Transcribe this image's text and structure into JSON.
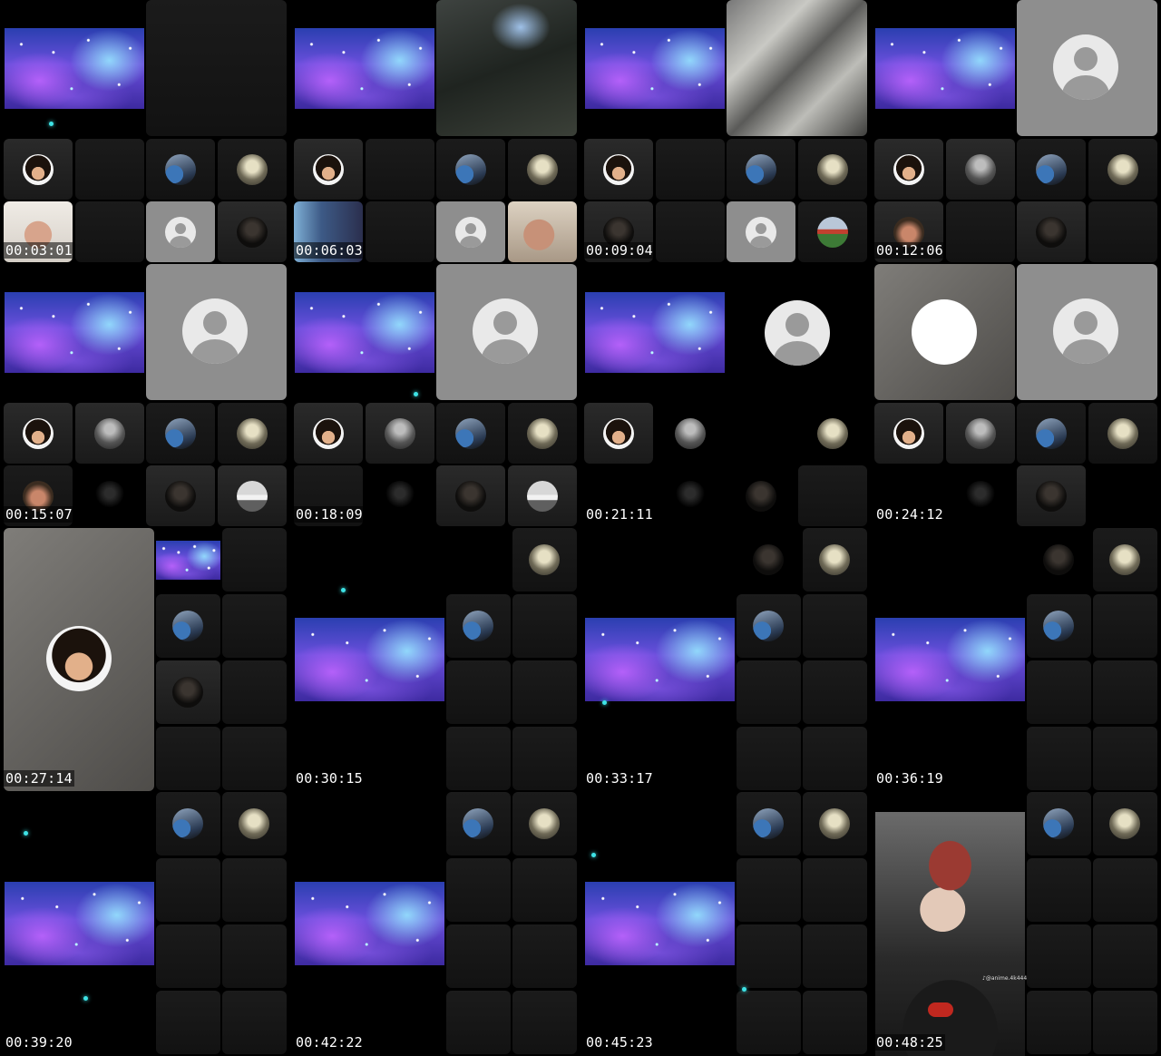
{
  "timestamps": [
    "00:03:01",
    "00:06:03",
    "00:09:04",
    "00:12:06",
    "00:15:07",
    "00:18:09",
    "00:21:11",
    "00:24:12",
    "00:27:14",
    "00:30:15",
    "00:33:17",
    "00:36:19",
    "00:39:20",
    "00:42:22",
    "00:45:23",
    "00:48:25"
  ],
  "overlay_text": {
    "anime_watermark": "♪@anime.4k444"
  },
  "colors": {
    "background": "#000000",
    "timestamp_text": "#ffffff",
    "glow_particle": "#3ee3e6",
    "default_avatar_bg": "#8e8e8e"
  },
  "icons": [
    "default-avatar-icon",
    "profile-avatar-icon",
    "nebula-wallpaper-image"
  ]
}
